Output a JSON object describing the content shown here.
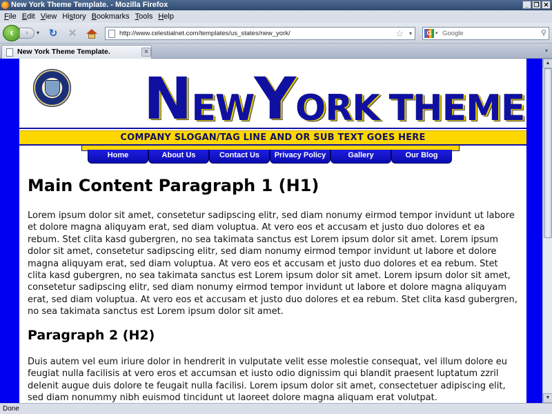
{
  "window": {
    "title": "New York Theme Template. - Mozilla Firefox",
    "buttons": {
      "minimize": "_",
      "restore": "❐",
      "close": "✕"
    }
  },
  "menubar": {
    "items": [
      {
        "key": "F",
        "rest": "ile"
      },
      {
        "key": "E",
        "rest": "dit"
      },
      {
        "key": "V",
        "rest": "iew"
      },
      {
        "key": "",
        "rest": "Hi",
        "key2": "s",
        "rest2": "tory"
      },
      {
        "key": "B",
        "rest": "ookmarks"
      },
      {
        "key": "T",
        "rest": "ools"
      },
      {
        "key": "H",
        "rest": "elp"
      }
    ]
  },
  "toolbar": {
    "back_icon": "‹",
    "forward_icon": "›",
    "history_drop": "▾",
    "reload_icon": "↻",
    "stop_icon": "✕",
    "url": "http://www.celestialnet.com/templates/us_states/new_york/",
    "bookmark_star": "☆",
    "url_drop": "▾",
    "search_engine": "G",
    "search_engine_drop": "▾",
    "search_placeholder": "Google",
    "search_go": "⚲"
  },
  "tabs": [
    {
      "label": "New York Theme Template.",
      "close": "×"
    }
  ],
  "tab_list_icon": "▾",
  "page": {
    "logo": {
      "n": "N",
      "ew": "EW",
      "y": "Y",
      "ork": "ORK",
      "theme": "THEME"
    },
    "slogan": "COMPANY SLOGAN/TAG LINE AND OR SUB TEXT GOES HERE",
    "nav": [
      "Home",
      "About Us",
      "Contact Us",
      "Privacy Policy",
      "Gallery",
      "Our Blog"
    ],
    "h1": "Main Content Paragraph 1 (H1)",
    "p1": "Lorem ipsum dolor sit amet, consetetur sadipscing elitr, sed diam nonumy eirmod tempor invidunt ut labore et dolore magna aliquyam erat, sed diam voluptua. At vero eos et accusam et justo duo dolores et ea rebum. Stet clita kasd gubergren, no sea takimata sanctus est Lorem ipsum dolor sit amet. Lorem ipsum dolor sit amet, consetetur sadipscing elitr, sed diam nonumy eirmod tempor invidunt ut labore et dolore magna aliquyam erat, sed diam voluptua. At vero eos et accusam et justo duo dolores et ea rebum. Stet clita kasd gubergren, no sea takimata sanctus est Lorem ipsum dolor sit amet. Lorem ipsum dolor sit amet, consetetur sadipscing elitr, sed diam nonumy eirmod tempor invidunt ut labore et dolore magna aliquyam erat, sed diam voluptua. At vero eos et accusam et justo duo dolores et ea rebum. Stet clita kasd gubergren, no sea takimata sanctus est Lorem ipsum dolor sit amet.",
    "h2": "Paragraph 2 (H2)",
    "p2": "Duis autem vel eum iriure dolor in hendrerit in vulputate velit esse molestie consequat, vel illum dolore eu feugiat nulla facilisis at vero eros et accumsan et iusto odio dignissim qui blandit praesent luptatum zzril delenit augue duis dolore te feugait nulla facilisi. Lorem ipsum dolor sit amet, consectetuer adipiscing elit, sed diam nonummy nibh euismod tincidunt ut laoreet dolore magna aliquam erat volutpat."
  },
  "scrollbar": {
    "up": "▲",
    "down": "▼"
  },
  "status": "Done",
  "colors": {
    "page_bg": "#0000f0",
    "accent_yellow": "#ffd700",
    "nav_blue": "#1010d0"
  }
}
